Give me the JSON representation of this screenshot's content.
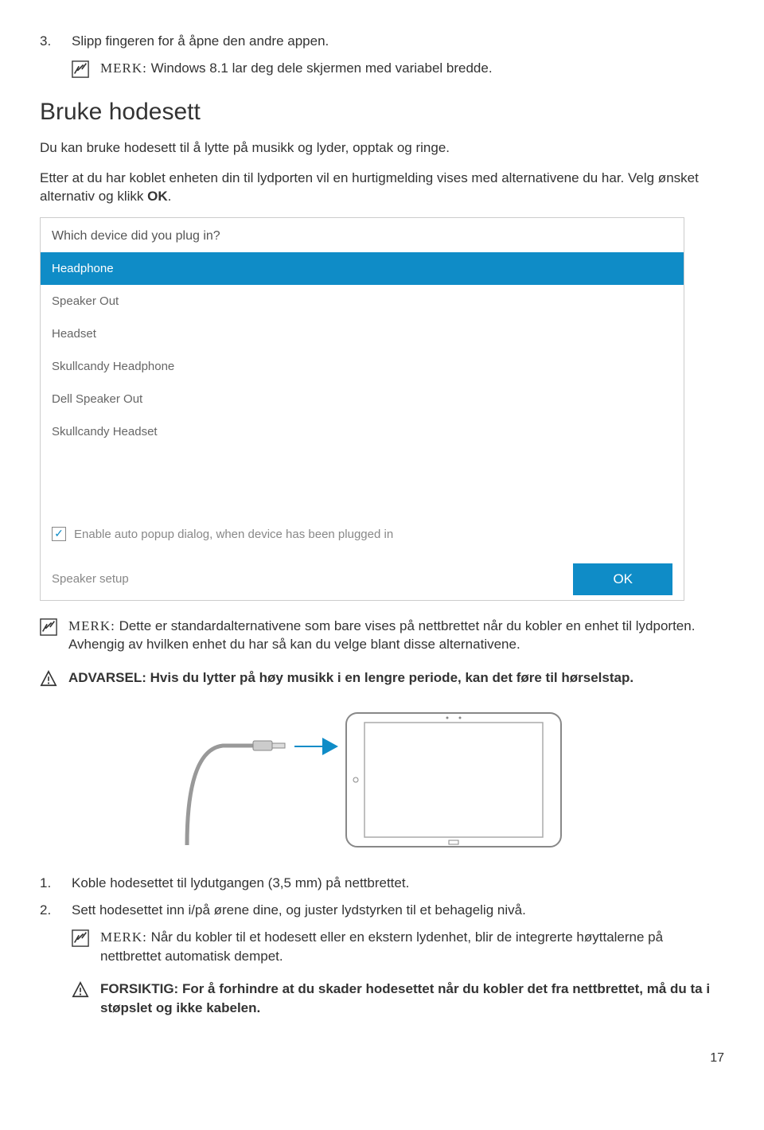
{
  "step3": {
    "num": "3.",
    "text": "Slipp fingeren for å åpne den andre appen."
  },
  "note1": {
    "label": "MERK:",
    "text": " Windows 8.1 lar deg dele skjermen med variabel bredde."
  },
  "heading": "Bruke hodesett",
  "intro": "Du kan bruke hodesett til å lytte på musikk og lyder, opptak og ringe.",
  "para2a": "Etter at du har koblet enheten din til lydporten vil en hurtigmelding vises med alternativene du har. Velg ønsket alternativ og klikk ",
  "para2b": "OK",
  "para2c": ".",
  "dialog": {
    "title": "Which device did you plug in?",
    "items": [
      "Headphone",
      "Speaker Out",
      "Headset",
      "Skullcandy Headphone",
      "Dell Speaker Out",
      "Skullcandy Headset"
    ],
    "checkboxLabel": "Enable auto popup dialog, when device has been plugged in",
    "footerLeft": "Speaker setup",
    "okButton": "OK"
  },
  "note2": {
    "label": "MERK:",
    "text": " Dette er standardalternativene som bare vises på nettbrettet når du kobler en enhet til lydporten. Avhengig av hvilken enhet du har så kan du velge blant disse alternativene."
  },
  "warning": {
    "label": "ADVARSEL: ",
    "text": "Hvis du lytter på høy musikk i en lengre periode, kan det føre til hørselstap."
  },
  "step1": {
    "num": "1.",
    "text": "Koble hodesettet til lydutgangen (3,5 mm) på nettbrettet."
  },
  "step2b": {
    "num": "2.",
    "text": "Sett hodesettet inn i/på ørene dine, og juster lydstyrken til et behagelig nivå."
  },
  "note3": {
    "label": "MERK:",
    "text": " Når du kobler til et hodesett eller en ekstern lydenhet, blir de integrerte høyttalerne på nettbrettet automatisk dempet."
  },
  "caution": {
    "label": "FORSIKTIG: ",
    "text": "For å forhindre at du skader hodesettet når du kobler det fra nettbrettet, må du ta i støpslet og ikke kabelen."
  },
  "pageNum": "17"
}
